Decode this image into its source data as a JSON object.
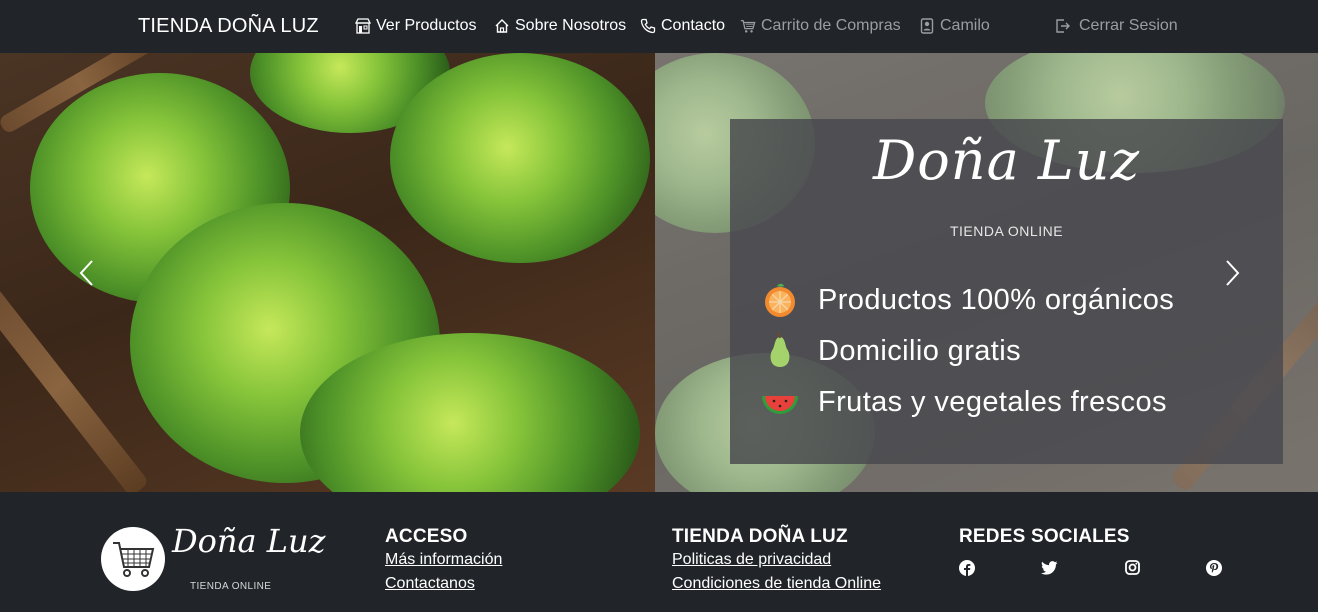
{
  "navbar": {
    "brand": "TIENDA DOÑA LUZ",
    "items": [
      {
        "label": "Ver Productos",
        "icon": "store-icon",
        "active": true
      },
      {
        "label": "Sobre Nosotros",
        "icon": "home-icon",
        "active": true
      },
      {
        "label": "Contacto",
        "icon": "phone-icon",
        "active": true
      },
      {
        "label": "Carrito de Compras",
        "icon": "cart-icon",
        "active": false
      },
      {
        "label": "Camilo",
        "icon": "user-badge-icon",
        "active": false
      },
      {
        "label": "Cerrar Sesion",
        "icon": "logout-icon",
        "active": false
      }
    ]
  },
  "hero": {
    "logo_script": "Doña Luz",
    "logo_sub": "TIENDA ONLINE",
    "features": [
      {
        "text": "Productos 100% orgánicos",
        "icon": "orange-icon"
      },
      {
        "text": "Domicilio gratis",
        "icon": "pear-icon"
      },
      {
        "text": "Frutas y vegetales frescos",
        "icon": "watermelon-icon"
      }
    ],
    "prev_icon": "chevron-left-icon",
    "next_icon": "chevron-right-icon"
  },
  "footer": {
    "logo_script": "Doña Luz",
    "logo_sub": "TIENDA ONLINE",
    "columns": [
      {
        "title": "ACCESO",
        "links": [
          "Más información",
          "Contactanos"
        ]
      },
      {
        "title": "TIENDA DOÑA LUZ",
        "links": [
          "Politicas de privacidad",
          "Condiciones de tienda Online"
        ]
      },
      {
        "title": "REDES SOCIALES",
        "links": []
      }
    ],
    "social": [
      "facebook-icon",
      "twitter-icon",
      "instagram-icon",
      "pinterest-icon"
    ]
  },
  "colors": {
    "navbar_bg": "#212529",
    "footer_bg": "#212529",
    "text_light": "#ffffff",
    "text_muted": "#9a9da1",
    "promo_box": "#48484e"
  }
}
